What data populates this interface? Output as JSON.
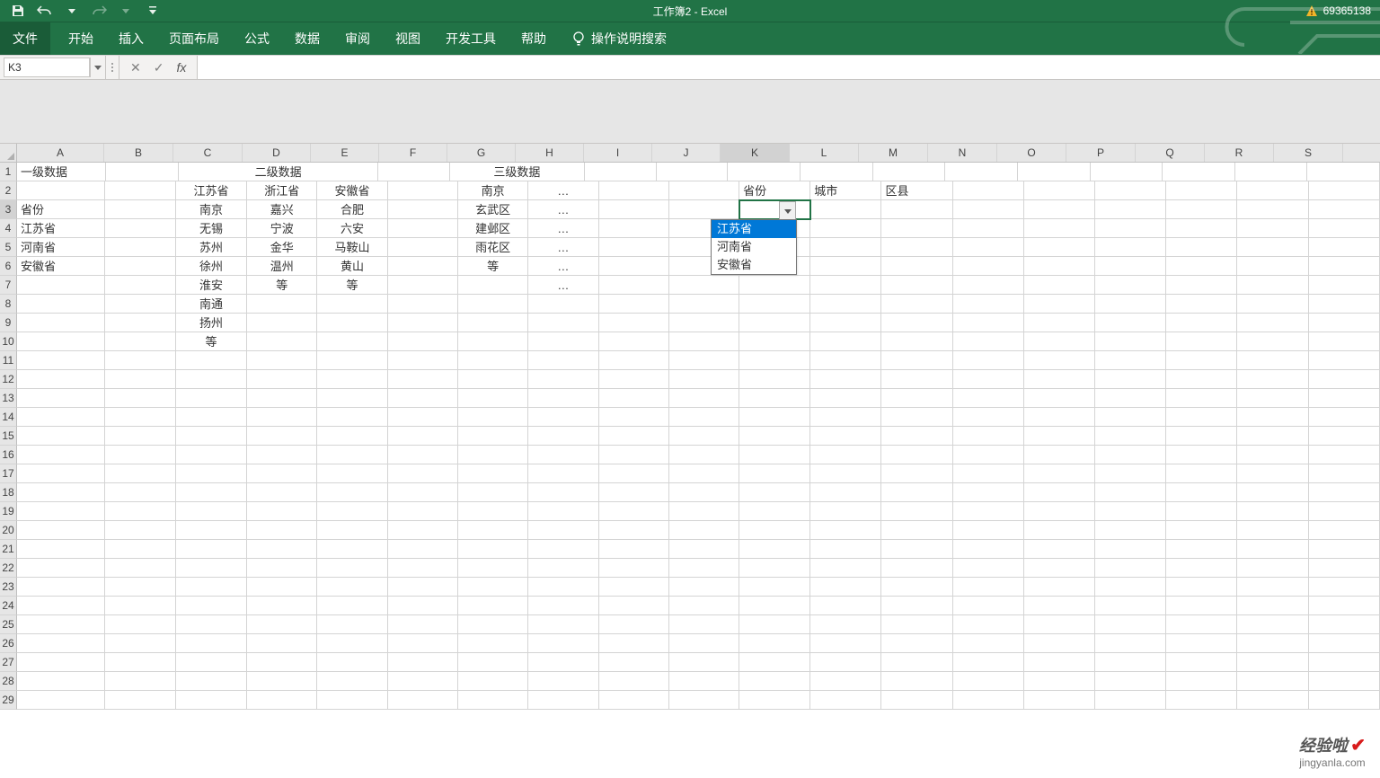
{
  "app": {
    "doc_title": "工作簿2 - Excel",
    "account": "69365138"
  },
  "qat": {
    "save": "save",
    "undo": "undo",
    "redo": "redo"
  },
  "ribbon": {
    "file": "文件",
    "tabs": [
      "开始",
      "插入",
      "页面布局",
      "公式",
      "数据",
      "审阅",
      "视图",
      "开发工具",
      "帮助"
    ],
    "search_label": "操作说明搜索"
  },
  "namebox": "K3",
  "formula": "",
  "columns": [
    "A",
    "B",
    "C",
    "D",
    "E",
    "F",
    "G",
    "H",
    "I",
    "J",
    "K",
    "L",
    "M",
    "N",
    "O",
    "P",
    "Q",
    "R",
    "S"
  ],
  "grid": {
    "A1": "一级数据",
    "A3": "省份",
    "A4": "江苏省",
    "A5": "河南省",
    "A6": "安徽省",
    "C1_merged": "二级数据",
    "C2": "江苏省",
    "D2": "浙江省",
    "E2": "安徽省",
    "C3": "南京",
    "D3": "嘉兴",
    "E3": "合肥",
    "C4": "无锡",
    "D4": "宁波",
    "E4": "六安",
    "C5": "苏州",
    "D5": "金华",
    "E5": "马鞍山",
    "C6": "徐州",
    "D6": "温州",
    "E6": "黄山",
    "C7": "淮安",
    "D7": "等",
    "E7": "等",
    "C8": "南通",
    "C9": "扬州",
    "C10": "等",
    "G1_merged": "三级数据",
    "G2": "南京",
    "H2": "…",
    "G3": "玄武区",
    "H3": "…",
    "G4": "建邺区",
    "H4": "…",
    "G5": "雨花区",
    "H5": "…",
    "G6": "等",
    "H6": "…",
    "H7": "…",
    "K2": "省份",
    "L2": "城市",
    "M2": "区县"
  },
  "dropdown": {
    "options": [
      "江苏省",
      "河南省",
      "安徽省"
    ],
    "selected_index": 0
  },
  "watermark": {
    "brand": "经验啦",
    "url": "jingyanla.com"
  }
}
